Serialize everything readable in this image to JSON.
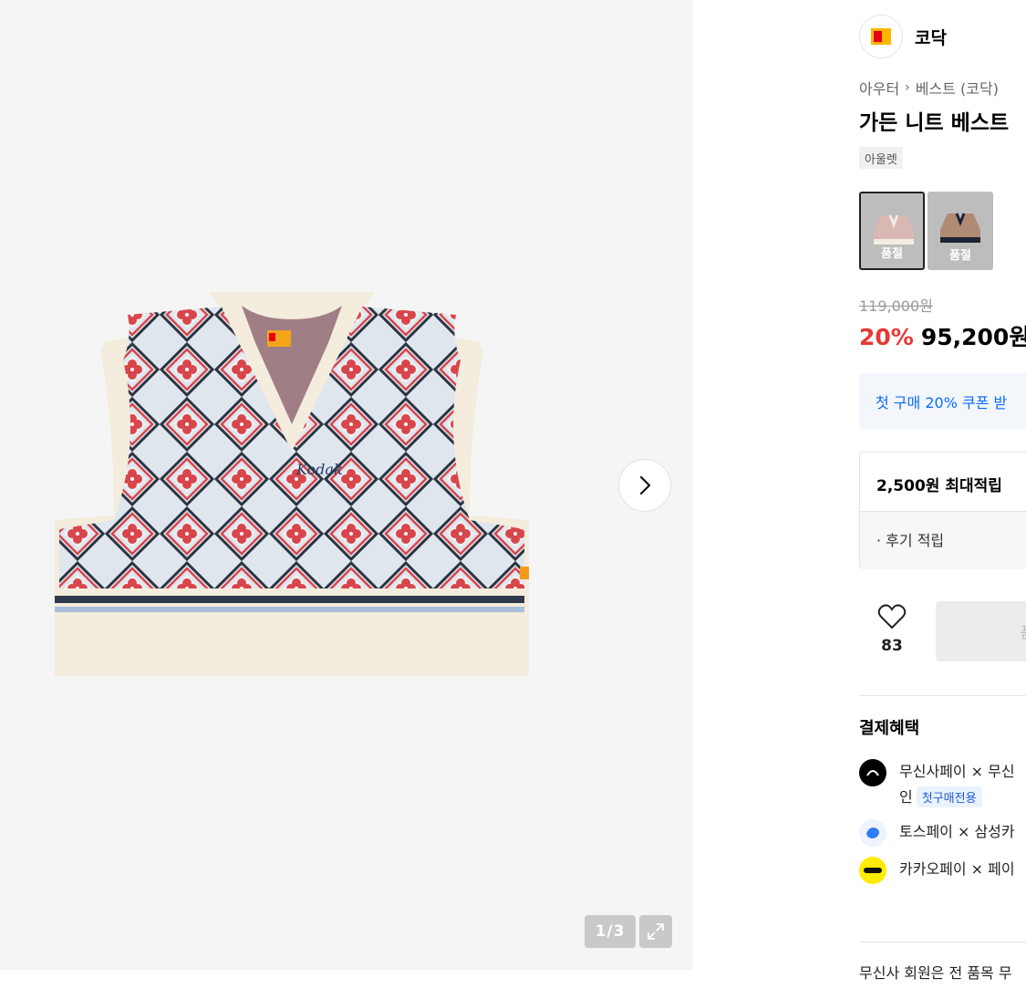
{
  "brand": {
    "name": "코닥",
    "logo_color": "#e60012",
    "logo_accent": "#ffb400"
  },
  "breadcrumb": {
    "category": "아우터",
    "subcategory": "베스트 (코닥)"
  },
  "product": {
    "title": "가든 니트 베스트 ",
    "tag": "아울렛",
    "original_price": "119,000원",
    "discount": "20%",
    "sale_price": "95,200원"
  },
  "gallery": {
    "pager": "1/3"
  },
  "swatches": [
    {
      "label": "품절",
      "color": "beige-pattern"
    },
    {
      "label": "품절",
      "color": "brown-pattern"
    }
  ],
  "coupon": {
    "text": "첫 구매 20% 쿠폰 받"
  },
  "points": {
    "title": "2,500원 최대적립",
    "sub": "· 후기 적립"
  },
  "like": {
    "count": "83"
  },
  "buy": {
    "label": "품"
  },
  "benefits": {
    "title": "결제혜택",
    "items": [
      {
        "text": "무신사페이 × 무신",
        "line2": "인",
        "badge": "첫구매전용"
      },
      {
        "text": "토스페이 × 삼성카"
      },
      {
        "text": "카카오페이 × 페이"
      }
    ]
  },
  "member_note": "무신사 회원은 전 품목 무",
  "colors": {
    "accent_red": "#e53935",
    "link_blue": "#0a6cff"
  }
}
